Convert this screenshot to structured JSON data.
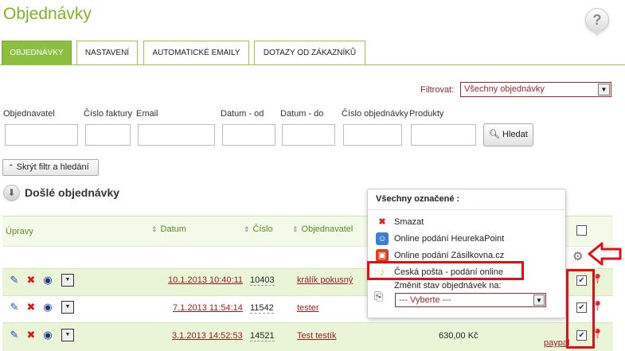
{
  "page": {
    "title": "Objednávky",
    "help_label": "?"
  },
  "tabs": [
    {
      "label": "OBJEDNÁVKY",
      "active": true
    },
    {
      "label": "NASTAVENÍ",
      "active": false
    },
    {
      "label": "AUTOMATICKÉ EMAILY",
      "active": false
    },
    {
      "label": "DOTAZY OD ZÁKAZNÍKŮ",
      "active": false
    }
  ],
  "filter": {
    "label": "Filtrovat:",
    "selected": "Všechny objednávky"
  },
  "search_fields": [
    {
      "label": "Objednavatel"
    },
    {
      "label": "Číslo faktury"
    },
    {
      "label": "Email"
    },
    {
      "label": "Datum - od"
    },
    {
      "label": "Datum - do"
    },
    {
      "label": "Číslo objednávky"
    },
    {
      "label": "Produkty"
    }
  ],
  "buttons": {
    "search": "Hledat",
    "hide_filter": "Skrýt filtr a hledání"
  },
  "section": {
    "title": "Došlé objednávky"
  },
  "table": {
    "columns": {
      "edit": "Úpravy",
      "date": "Datum",
      "number": "Číslo",
      "customer": "Objednavatel"
    },
    "rows": [
      {
        "date": "10.1.2013 10:40:11",
        "number": "10403",
        "customer": "králík pokusný",
        "price": "",
        "payment": "",
        "checked": true
      },
      {
        "date": "7.1.2013 11:54:14",
        "number": "11542",
        "customer": "tester",
        "price": "",
        "payment": "",
        "checked": true
      },
      {
        "date": "3.1.2013 14:52:53",
        "number": "14521",
        "customer": "Test testík",
        "price": "630,00 Kč",
        "payment": "paypal",
        "checked": true
      }
    ]
  },
  "bulk_popup": {
    "title": "Všechny označené :",
    "items": [
      {
        "label": "Smazat",
        "icon": "delete-icon"
      },
      {
        "label": "Online podání HeurekaPoint",
        "icon": "heureka-icon"
      },
      {
        "label": "Online podání Zásilkovna.cz",
        "icon": "zasilkovna-icon"
      },
      {
        "label": "Česká pošta - podání online",
        "icon": "ceska-posta-icon"
      }
    ],
    "change_state_label": "Změnit stav objednávek na:",
    "state_select": "--- Vyberte ---"
  },
  "colors": {
    "accent": "#8cbf3f",
    "link": "#9b1c1c",
    "highlight": "#e0101a",
    "row_bg": "#eaf5d8"
  }
}
